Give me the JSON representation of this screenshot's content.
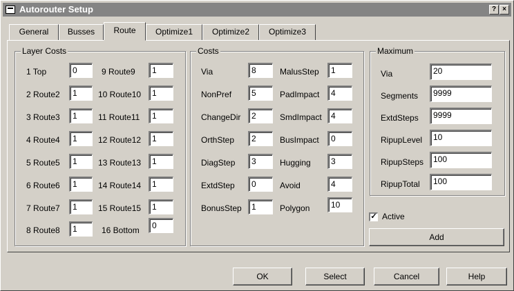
{
  "window": {
    "title": "Autorouter Setup",
    "help_glyph": "?",
    "close_glyph": "×"
  },
  "tabs": [
    "General",
    "Busses",
    "Route",
    "Optimize1",
    "Optimize2",
    "Optimize3"
  ],
  "layer_costs": {
    "label": "Layer Costs",
    "left": [
      {
        "label": "1 Top",
        "value": "0"
      },
      {
        "label": "2 Route2",
        "value": "1"
      },
      {
        "label": "3 Route3",
        "value": "1"
      },
      {
        "label": "4 Route4",
        "value": "1"
      },
      {
        "label": "5 Route5",
        "value": "1"
      },
      {
        "label": "6 Route6",
        "value": "1"
      },
      {
        "label": "7 Route7",
        "value": "1"
      },
      {
        "label": "8 Route8",
        "value": "1"
      }
    ],
    "right": [
      {
        "label": "9 Route9",
        "value": "1"
      },
      {
        "label": "10 Route10",
        "value": "1"
      },
      {
        "label": "11 Route11",
        "value": "1"
      },
      {
        "label": "12 Route12",
        "value": "1"
      },
      {
        "label": "13 Route13",
        "value": "1"
      },
      {
        "label": "14 Route14",
        "value": "1"
      },
      {
        "label": "15 Route15",
        "value": "1"
      },
      {
        "label": "16 Bottom",
        "value": "0"
      }
    ]
  },
  "costs": {
    "label": "Costs",
    "left": [
      {
        "label": "Via",
        "value": "8"
      },
      {
        "label": "NonPref",
        "value": "5"
      },
      {
        "label": "ChangeDir",
        "value": "2"
      },
      {
        "label": "OrthStep",
        "value": "2"
      },
      {
        "label": "DiagStep",
        "value": "3"
      },
      {
        "label": "ExtdStep",
        "value": "0"
      },
      {
        "label": "BonusStep",
        "value": "1"
      }
    ],
    "right": [
      {
        "label": "MalusStep",
        "value": "1"
      },
      {
        "label": "PadImpact",
        "value": "4"
      },
      {
        "label": "SmdImpact",
        "value": "4"
      },
      {
        "label": "BusImpact",
        "value": "0"
      },
      {
        "label": "Hugging",
        "value": "3"
      },
      {
        "label": "Avoid",
        "value": "4"
      },
      {
        "label": "Polygon",
        "value": "10"
      }
    ]
  },
  "maximum": {
    "label": "Maximum",
    "rows": [
      {
        "label": "Via",
        "value": "20"
      },
      {
        "label": "Segments",
        "value": "9999"
      },
      {
        "label": "ExtdSteps",
        "value": "9999"
      },
      {
        "label": "RipupLevel",
        "value": "10"
      },
      {
        "label": "RipupSteps",
        "value": "100"
      },
      {
        "label": "RipupTotal",
        "value": "100"
      }
    ]
  },
  "active": {
    "label": "Active",
    "checked": true,
    "mark": "✓"
  },
  "buttons": {
    "add": "Add",
    "ok": "OK",
    "select": "Select",
    "cancel": "Cancel",
    "help": "Help"
  }
}
